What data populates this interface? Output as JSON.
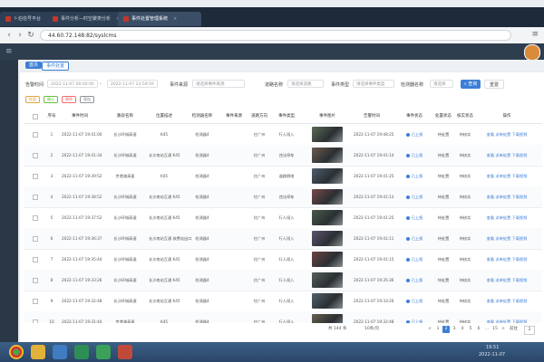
{
  "browser": {
    "tabs": [
      {
        "label": "ト伯信号平台"
      },
      {
        "label": "事件分析—时空聚类分析"
      },
      {
        "label": "事件处置管理系统"
      }
    ],
    "url": "44.60.72.148:82/syslcms"
  },
  "app": {
    "breadcrumb_home": "首页",
    "breadcrumb_active": "事件处置"
  },
  "filters": {
    "label_time": "告警时间",
    "start_time": "2022-11-07 00:00:00",
    "end_time": "2022-11-07 23:59:59",
    "label_source": "事件来源",
    "source_placeholder": "请选择事件来源",
    "label_road": "道路名称",
    "road_placeholder": "请选择道路",
    "label_type": "事件类型",
    "type_placeholder": "请选择事件类型",
    "label_device": "检测器名称",
    "device_placeholder": "请选择",
    "search_label": "查询",
    "reset_label": "重置"
  },
  "actions": {
    "batch": "批量",
    "confirm": "确认",
    "delete": "删除",
    "export": "导出"
  },
  "table": {
    "headers": [
      "序号",
      "事件时间",
      "路段名称",
      "位置描述",
      "检测器名称",
      "事件来源",
      "道路方向",
      "事件类型",
      "事件图片",
      "告警时间",
      "事件状态",
      "处置状态",
      "核实状态",
      "操作"
    ],
    "rows": [
      {
        "no": "1",
        "time": "2022-11-07 19:41:00",
        "road": "长沙环城高速",
        "loc": "K45",
        "device": "检测器4",
        "source": "",
        "dir": "往广州",
        "type": "行人闯入",
        "alarm": "2022-11-07 19:48:25",
        "status": "已上报",
        "handle": "待处置",
        "verify": "待核实",
        "ops": "查看  派单处置  下载视频"
      },
      {
        "no": "2",
        "time": "2022-11-07 19:41:34",
        "road": "长沙环城高速",
        "loc": "长沙南站互通 K45",
        "device": "检测器4",
        "source": "",
        "dir": "往广州",
        "type": "违法停车",
        "alarm": "2022-11-07 19:41:14",
        "status": "已上报",
        "handle": "待处置",
        "verify": "待核实",
        "ops": "查看  派单处置  下载视频"
      },
      {
        "no": "3",
        "time": "2022-11-07 19:39:52",
        "road": "京港澳高速",
        "loc": "K45",
        "device": "检测器4",
        "source": "",
        "dir": "往广州",
        "type": "道路拥堵",
        "alarm": "2022-11-07 19:41:25",
        "status": "已上报",
        "handle": "待处置",
        "verify": "待核实",
        "ops": "查看  派单处置  下载视频"
      },
      {
        "no": "4",
        "time": "2022-11-07 19:38:52",
        "road": "长沙环城高速",
        "loc": "长沙南站互通 K45",
        "device": "检测器4",
        "source": "",
        "dir": "往广州",
        "type": "违法停车",
        "alarm": "2022-11-07 19:41:13",
        "status": "已上报",
        "handle": "待处置",
        "verify": "待核实",
        "ops": "查看  派单处置  下载视频"
      },
      {
        "no": "5",
        "time": "2022-11-07 19:37:52",
        "road": "长沙环城高速",
        "loc": "长沙南站互通 K45",
        "device": "检测器4",
        "source": "",
        "dir": "往广州",
        "type": "行人闯入",
        "alarm": "2022-11-07 19:41:25",
        "status": "已上报",
        "handle": "待处置",
        "verify": "待核实",
        "ops": "查看  派单处置  下载视频"
      },
      {
        "no": "6",
        "time": "2022-11-07 19:36:37",
        "road": "长沙环城高速",
        "loc": "长沙南站互通 收费站出口",
        "device": "检测器4",
        "source": "",
        "dir": "往广州",
        "type": "行人闯入",
        "alarm": "2022-11-07 19:41:11",
        "status": "已上报",
        "handle": "待处置",
        "verify": "待核实",
        "ops": "查看  派单处置  下载视频"
      },
      {
        "no": "7",
        "time": "2022-11-07 19:35:44",
        "road": "长沙环城高速",
        "loc": "长沙南站互通 K45",
        "device": "检测器4",
        "source": "",
        "dir": "往广州",
        "type": "行人闯入",
        "alarm": "2022-11-07 19:41:15",
        "status": "已上报",
        "handle": "待处置",
        "verify": "待核实",
        "ops": "查看  派单处置  下载视频"
      },
      {
        "no": "8",
        "time": "2022-11-07 19:33:26",
        "road": "长沙环城高速",
        "loc": "长沙南站互通 K45",
        "device": "检测器4",
        "source": "",
        "dir": "往广州",
        "type": "行人闯入",
        "alarm": "2022-11-07 19:35:36",
        "status": "已上报",
        "handle": "待处置",
        "verify": "待核实",
        "ops": "查看  派单处置  下载视频"
      },
      {
        "no": "9",
        "time": "2022-11-07 19:32:48",
        "road": "长沙环城高速",
        "loc": "长沙南站互通 K45",
        "device": "检测器4",
        "source": "",
        "dir": "往广州",
        "type": "行人闯入",
        "alarm": "2022-11-07 19:33:26",
        "status": "已上报",
        "handle": "待处置",
        "verify": "待核实",
        "ops": "查看  派单处置  下载视频"
      },
      {
        "no": "10",
        "time": "2022-11-07 19:31:44",
        "road": "京港澳高速",
        "loc": "K45",
        "device": "检测器4",
        "source": "",
        "dir": "往广州",
        "type": "行人闯入",
        "alarm": "2022-11-07 19:32:48",
        "status": "已上报",
        "handle": "待处置",
        "verify": "待核实",
        "ops": "查看  派单处置  下载视频"
      }
    ]
  },
  "pagination": {
    "total": "共 144 条",
    "page_size": "10条/页",
    "pages": [
      "<",
      "1",
      "2",
      "3",
      "4",
      "5",
      "6",
      "...",
      "15",
      ">"
    ],
    "active_page": "2",
    "goto_label": "前往",
    "goto_value": "2"
  },
  "taskbar": {
    "time": "19:51",
    "date": "2022-11-07"
  }
}
